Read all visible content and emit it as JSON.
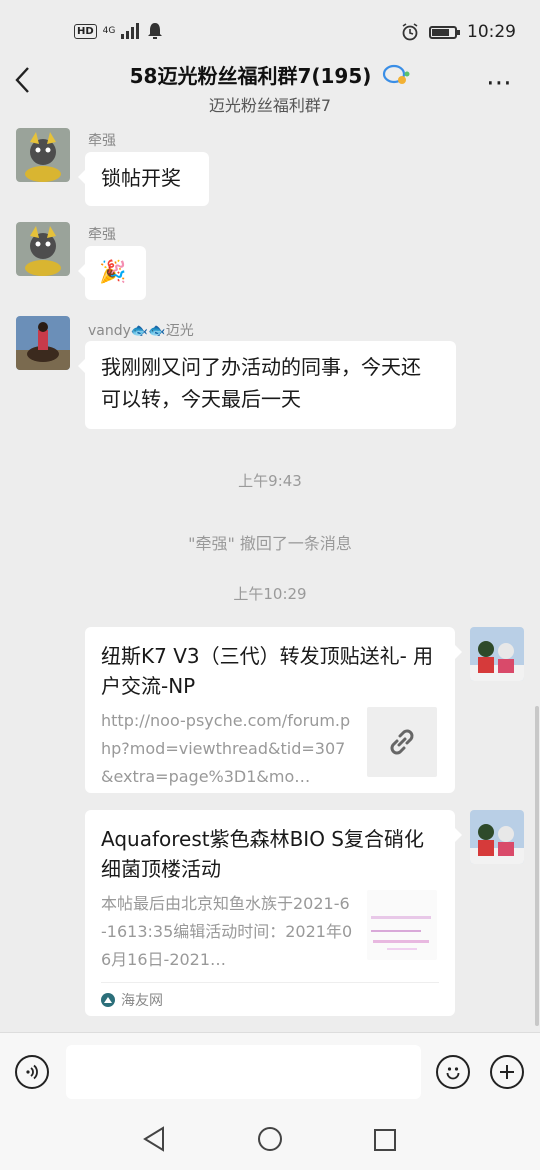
{
  "status_bar": {
    "hd": "HD",
    "network": "4G",
    "time": "10:29"
  },
  "header": {
    "title": "58迈光粉丝福利群7(195)",
    "subtitle": "迈光粉丝福利群7",
    "more_label": "⋯"
  },
  "messages": [
    {
      "sender": "牵强",
      "text": "锁帖开奖"
    },
    {
      "sender": "牵强",
      "text": "🎉"
    },
    {
      "sender": "vandy🐟🐟迈光",
      "text": "我刚刚又问了办活动的同事，今天还可以转，今天最后一天"
    }
  ],
  "time_divider_1": "上午9:43",
  "recall_note": "\"牵强\" 撤回了一条消息",
  "time_divider_2": "上午10:29",
  "link_cards": [
    {
      "title": "纽斯K7 V3（三代）转发顶贴送礼- 用户交流-NP",
      "desc": "http://noo-psyche.com/forum.php?mod=viewthread&tid=307&extra=page%3D1&mo…"
    },
    {
      "title": "Aquaforest紫色森林BIO S复合硝化细菌顶楼活动",
      "desc": "本帖最后由北京知鱼水族于2021-6-1613:35编辑活动时间：2021年06月16日-2021…",
      "source": "海友网"
    }
  ]
}
